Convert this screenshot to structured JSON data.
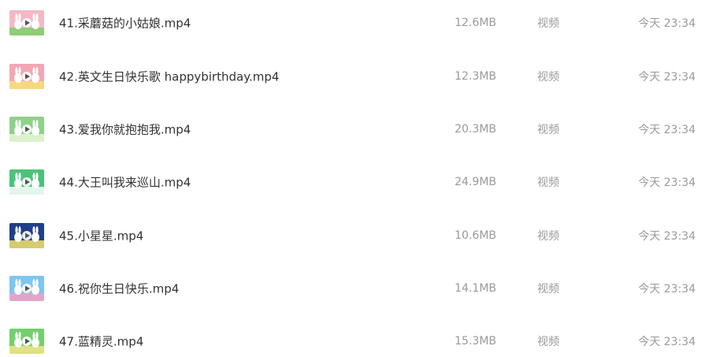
{
  "files": [
    {
      "name": "41.采蘑菇的小姑娘.mp4",
      "size": "12.6MB",
      "type": "视频",
      "date": "今天 23:34",
      "thumb_bg": "#f4b8c4",
      "thumb_accent": "#7fcf6a"
    },
    {
      "name": "42.英文生日快乐歌 happybirthday.mp4",
      "size": "12.3MB",
      "type": "视频",
      "date": "今天 23:34",
      "thumb_bg": "#f2a7b6",
      "thumb_accent": "#f7e07a"
    },
    {
      "name": "43.爱我你就抱抱我.mp4",
      "size": "20.3MB",
      "type": "视频",
      "date": "今天 23:34",
      "thumb_bg": "#8fd08a",
      "thumb_accent": "#e9f7d6"
    },
    {
      "name": "44.大王叫我来巡山.mp4",
      "size": "24.9MB",
      "type": "视频",
      "date": "今天 23:34",
      "thumb_bg": "#4cc27a",
      "thumb_accent": "#ffffff"
    },
    {
      "name": "45.小星星.mp4",
      "size": "10.6MB",
      "type": "视频",
      "date": "今天 23:34",
      "thumb_bg": "#1f3f8a",
      "thumb_accent": "#f6e46a"
    },
    {
      "name": "46.祝你生日快乐.mp4",
      "size": "14.1MB",
      "type": "视频",
      "date": "今天 23:34",
      "thumb_bg": "#7cc6f0",
      "thumb_accent": "#f3a0c0"
    },
    {
      "name": "47.蓝精灵.mp4",
      "size": "15.3MB",
      "type": "视频",
      "date": "今天 23:34",
      "thumb_bg": "#74cf6c",
      "thumb_accent": "#f5e48a"
    }
  ],
  "icons": {
    "thumbnail": "video-thumbnail-icon",
    "play": "play-icon"
  },
  "colors": {
    "name_text": "#333333",
    "meta_text": "#9a9a9a",
    "background": "#ffffff"
  }
}
